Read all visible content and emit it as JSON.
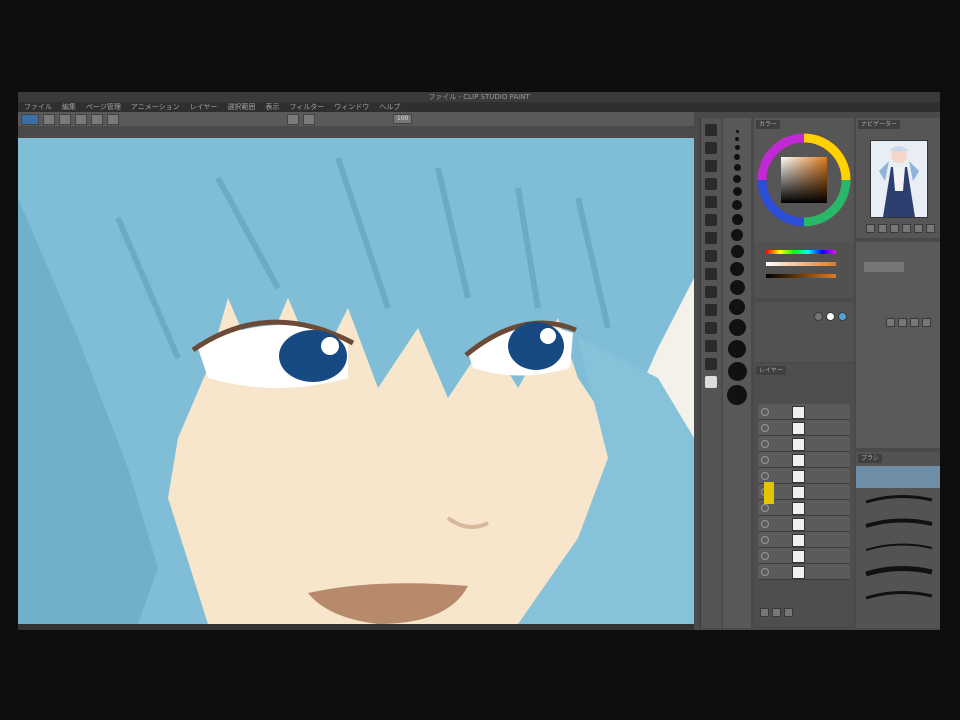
{
  "app": {
    "title": "ファイル - CLIP STUDIO PAINT",
    "menu": [
      "ファイル",
      "編集",
      "ページ管理",
      "アニメーション",
      "レイヤー",
      "選択範囲",
      "表示",
      "フィルター",
      "ウィンドウ",
      "ヘルプ"
    ],
    "toolopt_field": "100"
  },
  "palettes": {
    "color_tab": "カラー",
    "navigator_tab": "ナビゲーター",
    "layer_tab": "レイヤー",
    "brush_tab": "ブラシ"
  },
  "colors": {
    "hair": "#7fbed6",
    "hair_shadow": "#5c9fbb",
    "skin": "#f7e6cc",
    "lips": "#b78a6b",
    "iris": "#174a82",
    "accent": "#e3c400"
  },
  "icons": [
    "pen-icon",
    "eraser-icon",
    "fill-icon",
    "color-wheel-icon",
    "eye-icon",
    "layer-thumbnail-icon"
  ]
}
